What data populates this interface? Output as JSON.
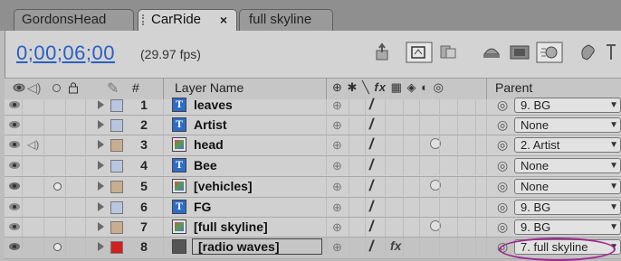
{
  "tabs": [
    {
      "label": "GordonsHead"
    },
    {
      "label": "CarRide",
      "close": "×"
    },
    {
      "label": "full skyline"
    }
  ],
  "toolbar": {
    "timecode": "0;00;06;00",
    "fps": "(29.97 fps)"
  },
  "columns": {
    "num": "#",
    "layer_name": "Layer Name",
    "parent": "Parent"
  },
  "layers": [
    {
      "num": "1",
      "name": "leaves",
      "type": "text",
      "label_color": "#b8c6e0",
      "parent": "9. BG",
      "cut": true
    },
    {
      "num": "2",
      "name": "Artist",
      "type": "text",
      "label_color": "#b8c6e0",
      "parent": "None"
    },
    {
      "num": "3",
      "name": "head",
      "type": "comp",
      "label_color": "#c9ad90",
      "parent": "2. Artist",
      "audio": true
    },
    {
      "num": "4",
      "name": "Bee",
      "type": "text",
      "label_color": "#b8c6e0",
      "parent": "None"
    },
    {
      "num": "5",
      "name": "[vehicles]",
      "type": "comp",
      "label_color": "#c9ad90",
      "parent": "None",
      "solo": true
    },
    {
      "num": "6",
      "name": "FG",
      "type": "text",
      "label_color": "#b8c6e0",
      "parent": "9. BG"
    },
    {
      "num": "7",
      "name": "[full skyline]",
      "type": "comp",
      "label_color": "#c9ad90",
      "parent": "9. BG"
    },
    {
      "num": "8",
      "name": "[radio waves]",
      "type": "solid",
      "label_color": "#d02020",
      "parent": "7. full skyline",
      "solo": true,
      "selected": true
    }
  ],
  "colors": {
    "timecode": "#2a5fc4",
    "highlight": "#a02890"
  }
}
